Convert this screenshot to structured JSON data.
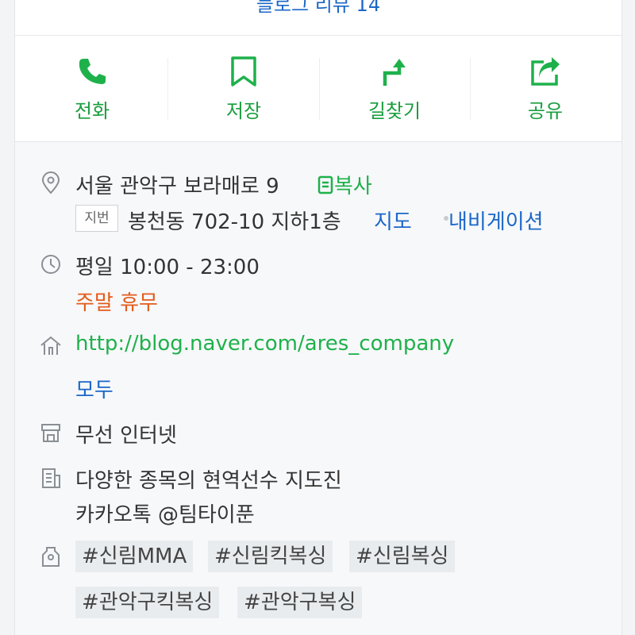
{
  "topbar": {
    "label": "블로그 리뷰 14"
  },
  "actions": [
    {
      "label": "전화",
      "icon": "phone-icon"
    },
    {
      "label": "저장",
      "icon": "bookmark-icon"
    },
    {
      "label": "길찾기",
      "icon": "directions-icon"
    },
    {
      "label": "공유",
      "icon": "share-icon"
    }
  ],
  "address": {
    "road": "서울 관악구 보라매로 9",
    "copy_label": "복사",
    "jibun_badge": "지번",
    "jibun": "봉천동 702-10 지하1층",
    "map_link": "지도",
    "nav_link": "내비게이션"
  },
  "hours": {
    "weekday": "평일 10:00 - 23:00",
    "weekend": "주말 휴무"
  },
  "website": {
    "url": "http://blog.naver.com/ares_company",
    "more": "모두"
  },
  "amenities": "무선 인터넷",
  "description": {
    "line1": "다양한 종목의 현역선수 지도진",
    "line2": "카카오톡 @팀타이푼"
  },
  "tags": [
    "#신림MMA",
    "#신림킥복싱",
    "#신림복싱",
    "#관악구킥복싱",
    "#관악구복싱"
  ],
  "colors": {
    "accent_green": "#1eb14b",
    "link_blue": "#1b67c7",
    "closed_orange": "#e35b1a"
  }
}
